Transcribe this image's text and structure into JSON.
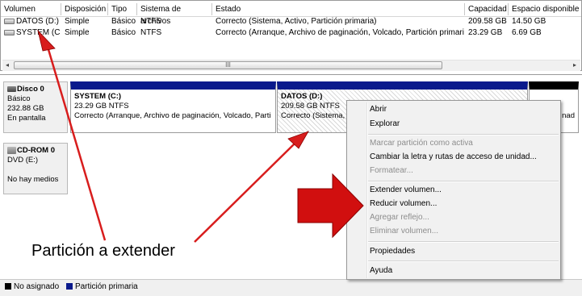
{
  "columns": [
    "Volumen",
    "Disposición",
    "Tipo",
    "Sistema de archivos",
    "Estado",
    "Capacidad",
    "Espacio disponible"
  ],
  "volumes": [
    {
      "name": "DATOS (D:)",
      "layout": "Simple",
      "type": "Básico",
      "fs": "NTFS",
      "status": "Correcto (Sistema, Activo, Partición primaria)",
      "capacity": "209.58 GB",
      "free": "14.50 GB"
    },
    {
      "name": "SYSTEM (C:)",
      "layout": "Simple",
      "type": "Básico",
      "fs": "NTFS",
      "status": "Correcto (Arranque, Archivo de paginación, Volcado, Partición primaria)",
      "capacity": "23.29 GB",
      "free": "6.69 GB"
    }
  ],
  "scroll_left": "◂",
  "scroll_right": "▸",
  "scroll_grip": "III",
  "disk0": {
    "title": "Disco 0",
    "type": "Básico",
    "size": "232.88 GB",
    "state": "En pantalla"
  },
  "cdrom0": {
    "title": "CD-ROM 0",
    "drive": "DVD (E:)",
    "state": "No hay medios"
  },
  "part_system": {
    "name": "SYSTEM  (C:)",
    "size": "23.29 GB NTFS",
    "status": "Correcto (Arranque, Archivo de paginación, Volcado, Parti"
  },
  "part_datos": {
    "name": "DATOS  (D:)",
    "size": "209.58 GB NTFS",
    "status": "Correcto (Sistema,"
  },
  "part_third_fragment": "nad",
  "menu": {
    "open": "Abrir",
    "explore": "Explorar",
    "mark_active": "Marcar partición como activa",
    "change_letter": "Cambiar la letra y rutas de acceso de unidad...",
    "format": "Formatear...",
    "extend": "Extender volumen...",
    "shrink": "Reducir volumen...",
    "add_mirror": "Agregar reflejo...",
    "delete": "Eliminar volumen...",
    "properties": "Propiedades",
    "help": "Ayuda"
  },
  "legend": {
    "unallocated": "No asignado",
    "primary": "Partición primaria"
  },
  "annotation_caption": "Partición a extender",
  "colors": {
    "primary_partition": "#0a1a8c",
    "unallocated": "#000000",
    "arrow": "#d81d1d"
  }
}
